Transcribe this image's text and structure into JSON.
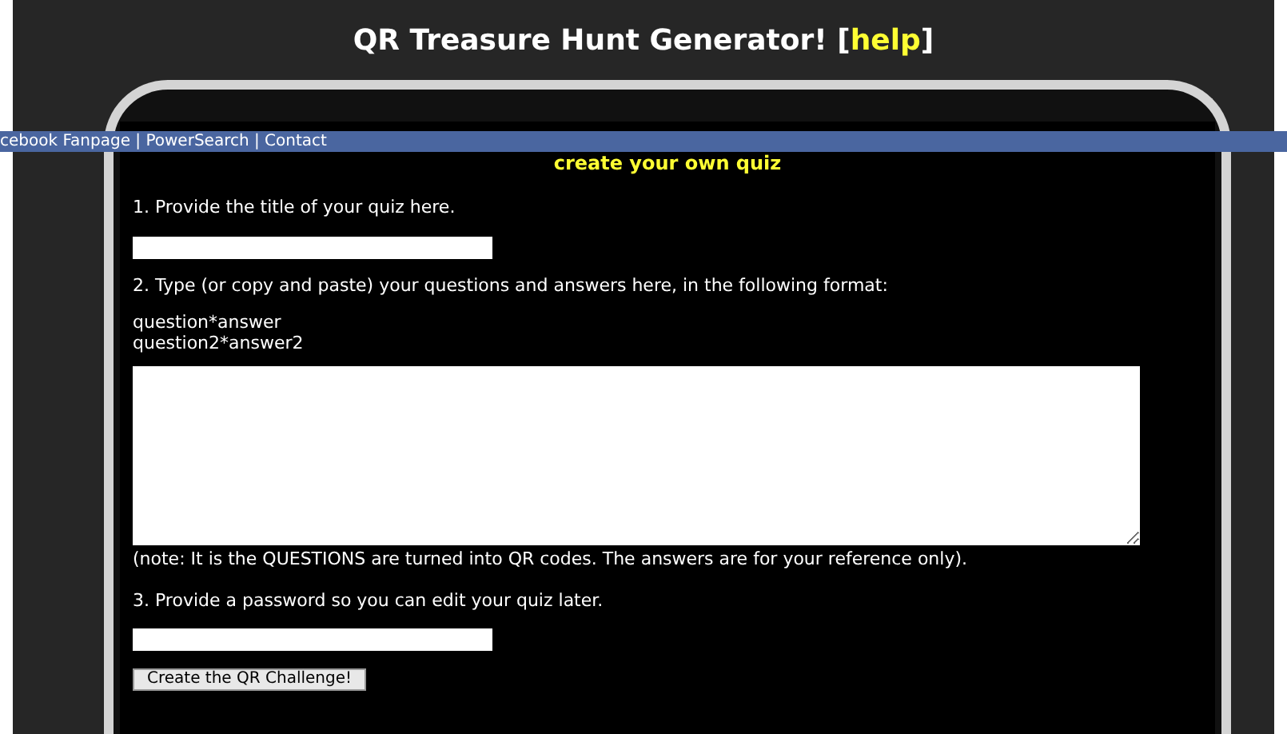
{
  "header": {
    "title": "QR Treasure Hunt Generator! [",
    "link": "help",
    "title_end": "]"
  },
  "nav_bar": {
    "text": "cebook Fanpage | PowerSearch | Contact"
  },
  "form": {
    "heading": "create your own quiz",
    "step1": "1. Provide the title of your quiz here.",
    "step2": "2. Type (or copy and paste) your questions and answers here, in the following format:",
    "format_lines": [
      "question*answer",
      "question2*answer2"
    ],
    "note": "(note: It is the QUESTIONS are turned into QR codes. The answers are for your reference only).",
    "step3": "3. Provide a password so you can edit your quiz later.",
    "submit": "Create the QR Challenge!"
  }
}
